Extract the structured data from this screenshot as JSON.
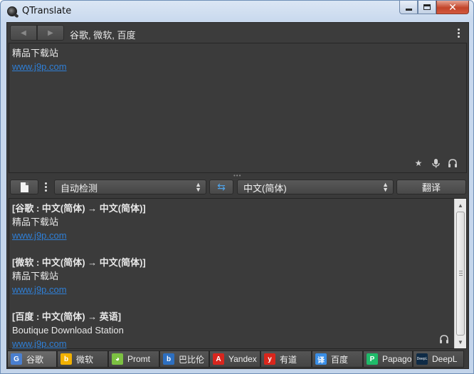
{
  "window": {
    "title": "QTranslate"
  },
  "toolbar": {
    "back_glyph": "◀",
    "forward_glyph": "▶",
    "providers_label": "谷歌, 微软, 百度"
  },
  "source": {
    "lines": [
      "精品下载站",
      "www.j9p.com"
    ]
  },
  "source_icons": [
    "star-icon",
    "microphone-icon",
    "headphones-icon"
  ],
  "lang_bar": {
    "source_lang": "自动检测",
    "target_lang": "中文(简体)",
    "swap_glyph": "⇆",
    "translate_label": "翻译"
  },
  "results": [
    {
      "header": "[谷歌 : 中文(简体) → 中文(简体)]",
      "text": "精品下载站",
      "link": "www.j9p.com"
    },
    {
      "header": "[微软 : 中文(简体) → 中文(简体)]",
      "text": "精品下载站",
      "link": "www.j9p.com"
    },
    {
      "header": "[百度 : 中文(简体) → 英语]",
      "text": "Boutique Download Station",
      "link": "www.j9p.com"
    }
  ],
  "tabs": [
    {
      "label": "谷歌",
      "icon": "google-icon",
      "glyph": "G",
      "color": "#4a7fd0",
      "active": true
    },
    {
      "label": "微软",
      "icon": "bing-icon",
      "glyph": "b",
      "color": "#f2b100",
      "active": false
    },
    {
      "label": "Promt",
      "icon": "promt-icon",
      "glyph": "◕",
      "color": "#7cc142",
      "active": false
    },
    {
      "label": "巴比伦",
      "icon": "babylon-icon",
      "glyph": "b",
      "color": "#2d6fc0",
      "active": false
    },
    {
      "label": "Yandex",
      "icon": "yandex-icon",
      "glyph": "A",
      "color": "#d8261e",
      "active": false
    },
    {
      "label": "有道",
      "icon": "youdao-icon",
      "glyph": "y",
      "color": "#d9261c",
      "active": false
    },
    {
      "label": "百度",
      "icon": "baidu-icon",
      "glyph": "译",
      "color": "#3a8ee6",
      "active": false
    },
    {
      "label": "Papago",
      "icon": "papago-icon",
      "glyph": "P",
      "color": "#1fbb6a",
      "active": false
    },
    {
      "label": "DeepL",
      "icon": "deepl-icon",
      "glyph": "DeepL",
      "color": "#0f2b46",
      "active": false
    }
  ]
}
